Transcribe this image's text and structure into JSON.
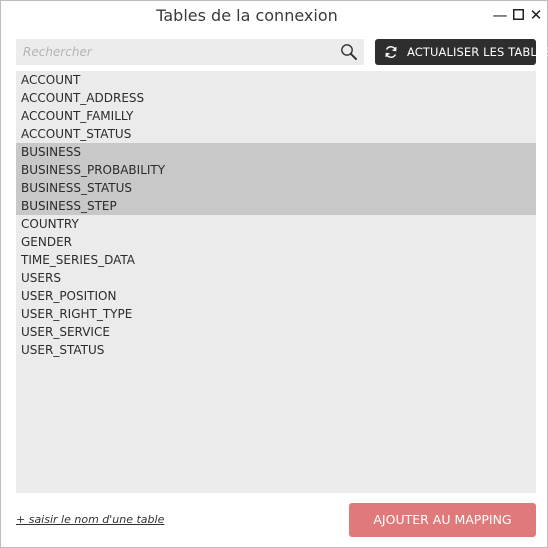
{
  "window": {
    "title": "Tables de la connexion",
    "controls": {
      "minimize": "—",
      "close": "✕"
    }
  },
  "search": {
    "placeholder": "Rechercher",
    "value": "",
    "icon": "search-icon"
  },
  "toolbar": {
    "refresh_label": "ACTUALISER LES TABLES",
    "refresh_icon": "refresh-icon"
  },
  "tables": [
    {
      "name": "ACCOUNT",
      "selected": false
    },
    {
      "name": "ACCOUNT_ADDRESS",
      "selected": false
    },
    {
      "name": "ACCOUNT_FAMILLY",
      "selected": false
    },
    {
      "name": "ACCOUNT_STATUS",
      "selected": false
    },
    {
      "name": "BUSINESS",
      "selected": true
    },
    {
      "name": "BUSINESS_PROBABILITY",
      "selected": true
    },
    {
      "name": "BUSINESS_STATUS",
      "selected": true
    },
    {
      "name": "BUSINESS_STEP",
      "selected": true
    },
    {
      "name": "COUNTRY",
      "selected": false
    },
    {
      "name": "GENDER",
      "selected": false
    },
    {
      "name": "TIME_SERIES_DATA",
      "selected": false
    },
    {
      "name": "USERS",
      "selected": false
    },
    {
      "name": "USER_POSITION",
      "selected": false
    },
    {
      "name": "USER_RIGHT_TYPE",
      "selected": false
    },
    {
      "name": "USER_SERVICE",
      "selected": false
    },
    {
      "name": "USER_STATUS",
      "selected": false
    }
  ],
  "footer": {
    "manual_link": "+ saisir le nom d'une table",
    "add_button": "AJOUTER AU MAPPING"
  },
  "colors": {
    "accent_button": "#e07a7a",
    "dark_button": "#2e2e2e",
    "list_background": "#ebebeb",
    "selected_row": "#c8c8c8"
  }
}
